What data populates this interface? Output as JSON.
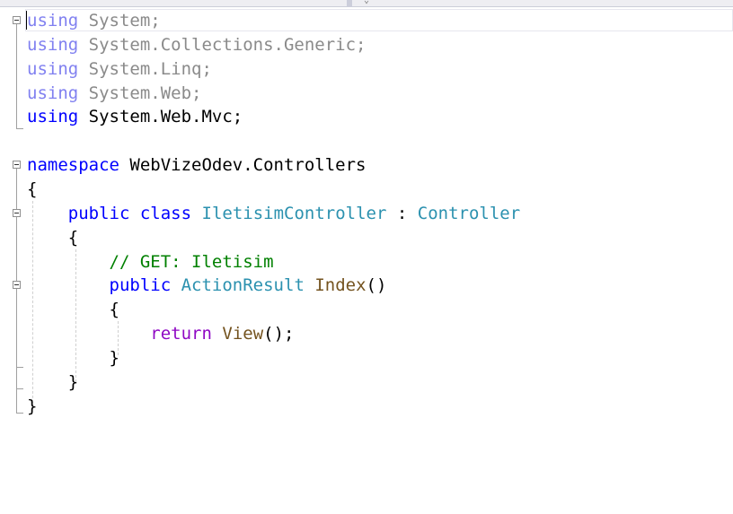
{
  "colors": {
    "keyword": "#0000ff",
    "keyword_unused": "#8080f0",
    "text_unused": "#8a8a8a",
    "type": "#2b91af",
    "method": "#74531f",
    "comment": "#008000",
    "control_keyword": "#8f08c4",
    "text": "#000000"
  },
  "editor": {
    "lines": [
      {
        "parts": [
          {
            "k": "kw",
            "t": "using"
          },
          {
            "k": "txt",
            "t": " System;"
          }
        ],
        "unused": true
      },
      {
        "parts": [
          {
            "k": "kw",
            "t": "using"
          },
          {
            "k": "txt",
            "t": " System.Collections.Generic;"
          }
        ],
        "unused": true
      },
      {
        "parts": [
          {
            "k": "kw",
            "t": "using"
          },
          {
            "k": "txt",
            "t": " System.Linq;"
          }
        ],
        "unused": true
      },
      {
        "parts": [
          {
            "k": "kw",
            "t": "using"
          },
          {
            "k": "txt",
            "t": " System.Web;"
          }
        ],
        "unused": true
      },
      {
        "parts": [
          {
            "k": "kw",
            "t": "using"
          },
          {
            "k": "txt",
            "t": " System.Web.Mvc;"
          }
        ]
      },
      {
        "parts": []
      },
      {
        "parts": [
          {
            "k": "kw",
            "t": "namespace"
          },
          {
            "k": "txt",
            "t": " WebVizeOdev.Controllers"
          }
        ]
      },
      {
        "parts": [
          {
            "k": "txt",
            "t": "{"
          }
        ]
      },
      {
        "parts": [
          {
            "k": "txt",
            "t": "    "
          },
          {
            "k": "kw",
            "t": "public"
          },
          {
            "k": "txt",
            "t": " "
          },
          {
            "k": "kw",
            "t": "class"
          },
          {
            "k": "txt",
            "t": " "
          },
          {
            "k": "type",
            "t": "IletisimController"
          },
          {
            "k": "txt",
            "t": " : "
          },
          {
            "k": "type",
            "t": "Controller"
          }
        ]
      },
      {
        "parts": [
          {
            "k": "txt",
            "t": "    {"
          }
        ]
      },
      {
        "parts": [
          {
            "k": "txt",
            "t": "        "
          },
          {
            "k": "comment",
            "t": "// GET: Iletisim"
          }
        ]
      },
      {
        "parts": [
          {
            "k": "txt",
            "t": "        "
          },
          {
            "k": "kw",
            "t": "public"
          },
          {
            "k": "txt",
            "t": " "
          },
          {
            "k": "type",
            "t": "ActionResult"
          },
          {
            "k": "txt",
            "t": " "
          },
          {
            "k": "method",
            "t": "Index"
          },
          {
            "k": "txt",
            "t": "()"
          }
        ]
      },
      {
        "parts": [
          {
            "k": "txt",
            "t": "        {"
          }
        ]
      },
      {
        "parts": [
          {
            "k": "txt",
            "t": "            "
          },
          {
            "k": "ctrl",
            "t": "return"
          },
          {
            "k": "txt",
            "t": " "
          },
          {
            "k": "method",
            "t": "View"
          },
          {
            "k": "txt",
            "t": "();"
          }
        ]
      },
      {
        "parts": [
          {
            "k": "txt",
            "t": "        }"
          }
        ]
      },
      {
        "parts": [
          {
            "k": "txt",
            "t": "    }"
          }
        ]
      },
      {
        "parts": [
          {
            "k": "txt",
            "t": "}"
          }
        ]
      }
    ]
  }
}
